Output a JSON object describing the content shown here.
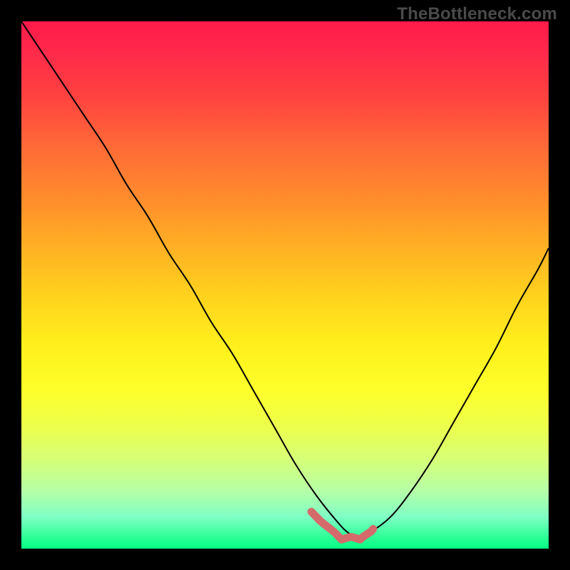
{
  "watermark": "TheBottleneck.com",
  "chart_data": {
    "type": "line",
    "title": "",
    "xlabel": "",
    "ylabel": "",
    "xlim": [
      0,
      100
    ],
    "ylim": [
      0,
      100
    ],
    "grid": false,
    "background": "heatmap-gradient (red high, green low)",
    "series": [
      {
        "name": "bottleneck-curve",
        "color": "#000000",
        "x": [
          0,
          4,
          8,
          12,
          16,
          20,
          24,
          28,
          32,
          36,
          40,
          44,
          48,
          52,
          56,
          60,
          62,
          64,
          66,
          70,
          74,
          78,
          82,
          86,
          90,
          94,
          98,
          100
        ],
        "values": [
          100,
          94,
          88,
          82,
          76,
          69,
          63,
          56,
          50,
          43,
          37,
          30,
          23,
          16,
          10,
          5,
          3,
          2,
          3,
          6,
          11,
          17,
          24,
          31,
          38,
          46,
          53,
          57
        ]
      }
    ],
    "annotations": [
      {
        "name": "valley-marker",
        "color": "#d56a6a",
        "description": "highlighted segment along curve near minimum",
        "x": [
          55,
          57,
          59,
          61,
          62,
          63,
          64,
          65,
          66,
          67
        ],
        "values": [
          7,
          5,
          3,
          2,
          2,
          2,
          2,
          2,
          3,
          4
        ]
      }
    ]
  }
}
